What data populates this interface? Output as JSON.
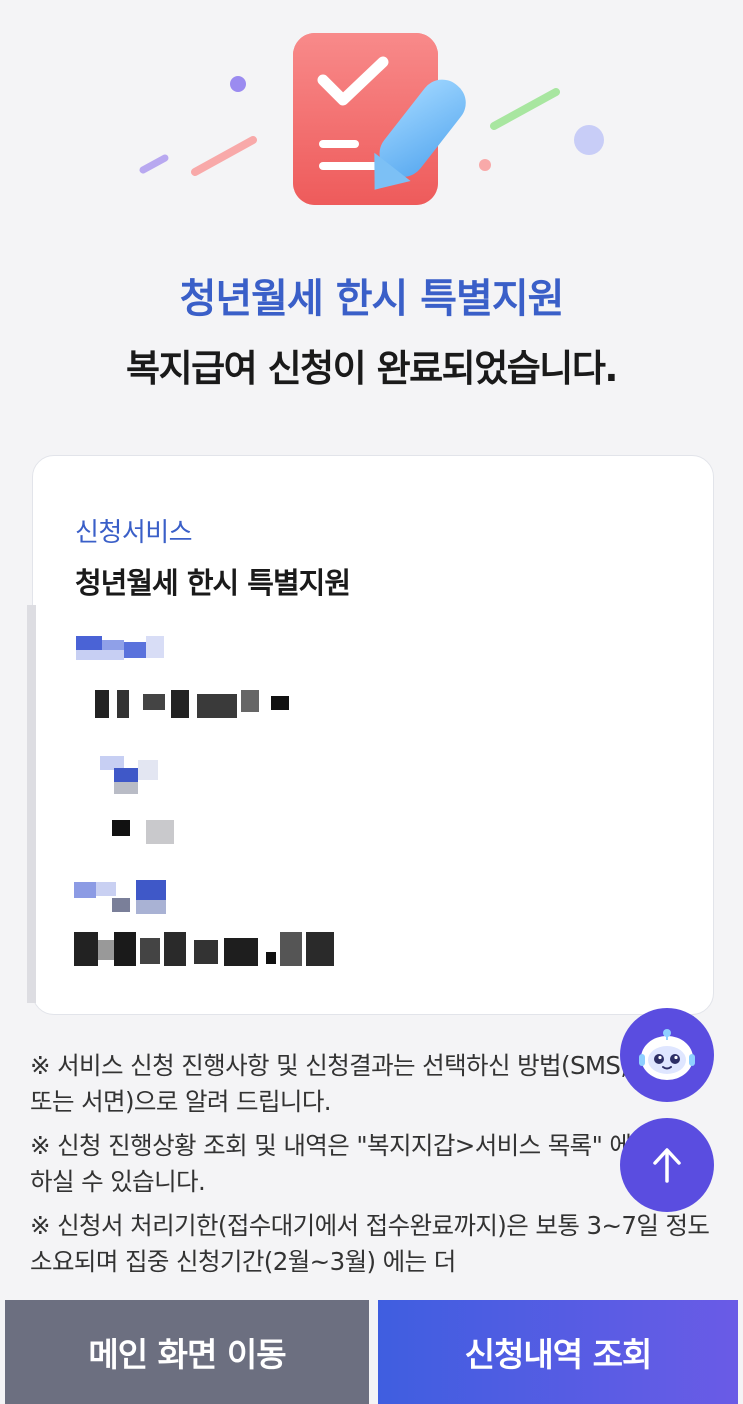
{
  "header": {
    "title_highlight": "청년월세 한시 특별지원",
    "title_main": "복지급여 신청이 완료되었습니다."
  },
  "card": {
    "service_label": "신청서비스",
    "service_value": "청년월세 한시 특별지원"
  },
  "notes": [
    "※ 서비스 신청 진행사항 및 신청결과는 선택하신 방법(SMS, E-mail 또는 서면)으로 알려 드립니다.",
    "※ 신청 진행상황 조회 및 내역은 \"복지지갑>서비스 목록\" 에서 확인하실 수 있습니다.",
    "※ 신청서 처리기한(접수대기에서 접수완료까지)은 보통 3~7일 정도 소요되며 집중 신청기간(2월~3월) 에는 더"
  ],
  "floating": {
    "chatbot_icon": "chatbot-icon",
    "scroll_top_icon": "arrow-up-icon"
  },
  "buttons": {
    "main_label": "메인 화면 이동",
    "history_label": "신청내역 조회"
  },
  "colors": {
    "accent_blue": "#3a5fc8",
    "primary_button": "#3f5ee0",
    "secondary_button": "#6c6f80",
    "fab": "#5a4de0"
  }
}
